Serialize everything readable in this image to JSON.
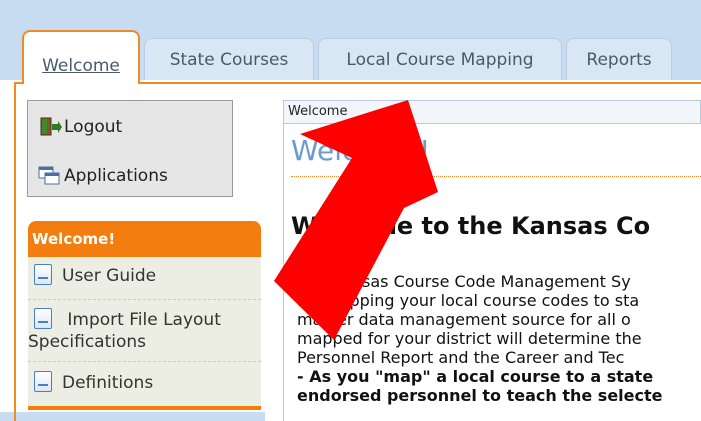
{
  "tabs": [
    {
      "label": "Welcome",
      "active": true
    },
    {
      "label": "State Courses",
      "active": false
    },
    {
      "label": "Local Course Mapping",
      "active": false
    },
    {
      "label": "Reports",
      "active": false
    }
  ],
  "app_panel": {
    "logout_label": "Logout",
    "applications_label": "Applications"
  },
  "sidebar": {
    "header": "Welcome!",
    "items": [
      {
        "label": "User Guide"
      },
      {
        "label_line1": "Import File Layout",
        "label_line2": "Specifications"
      },
      {
        "label": "Definitions"
      }
    ]
  },
  "main": {
    "breadcrumb": "Welcome",
    "panel_title": "Welcome!",
    "heading": "Welcome to the Kansas Co",
    "paragraph_lines": [
      "The Kansas Course Code Management Sy",
      "for mapping your local course codes to sta",
      "master data management source for all o",
      "mapped for your district will determine the",
      "Personnel Report and the Career and Tec"
    ],
    "bold_lines": [
      "- As you \"map\" a local course to a state",
      "endorsed personnel to teach the selecte"
    ]
  },
  "colors": {
    "accent_orange": "#f47d0f",
    "top_band": "#c7dcf0",
    "arrow_red": "#ff0000",
    "title_blue": "#6a9ad0"
  },
  "icons": [
    "logout-icon",
    "applications-icon",
    "document-icon",
    "red-arrow-annotation"
  ]
}
